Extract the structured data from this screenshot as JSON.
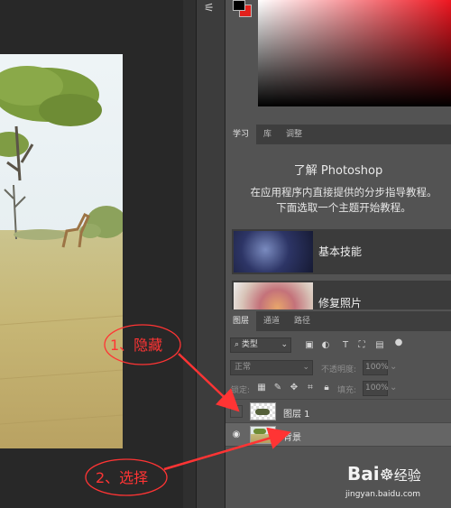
{
  "learn_panel": {
    "tabs": [
      "学习",
      "库",
      "调整"
    ],
    "title": "了解 Photoshop",
    "desc_line1": "在应用程序内直接提供的分步指导教程。",
    "desc_line2": "下面选取一个主题开始教程。",
    "cards": [
      {
        "label": "基本技能"
      },
      {
        "label": "修复照片"
      }
    ]
  },
  "layers_panel": {
    "tabs": [
      "图层",
      "通道",
      "路径"
    ],
    "filter_label": "类型",
    "blend_mode": "正常",
    "opacity_label": "不透明度:",
    "opacity_value": "100%",
    "lock_label": "锁定:",
    "fill_label": "填充:",
    "fill_value": "100%",
    "layers": [
      {
        "name": "图层 1",
        "visible": false
      },
      {
        "name": "背景",
        "visible": true
      }
    ]
  },
  "annotations": {
    "step1": "1、隐藏",
    "step2": "2、选择",
    "color": "#ff3434"
  },
  "colors": {
    "foreground": "#000000",
    "background": "#e3211c"
  },
  "watermark": {
    "brand": "Bai",
    "brand2": "经验",
    "url": "jingyan.baidu.com"
  }
}
